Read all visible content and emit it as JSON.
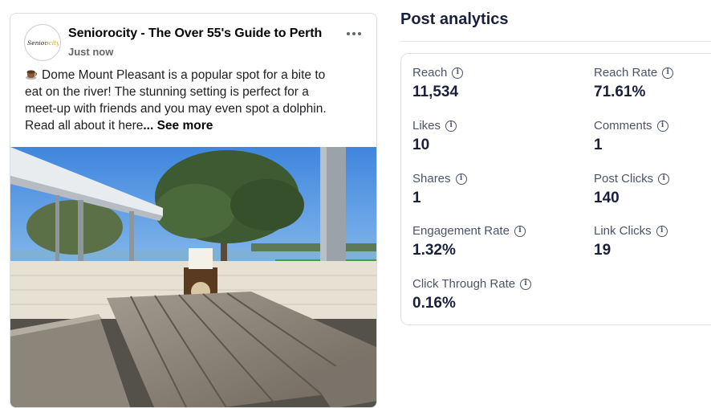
{
  "post": {
    "page_name": "Seniorocity - The Over 55's Guide to Perth",
    "avatar_logo_text": "Seniorocity",
    "time": "Just now",
    "text_lines": [
      "Dome Mount Pleasant is a popular spot for a bite to",
      "eat on the river! The stunning setting is perfect for a",
      "meet-up with friends and you may even spot a dolphin.",
      "Read all about it here... "
    ],
    "see_more": "... See more",
    "text_line4": "Read all about it here",
    "emoji_icon": "coffee-cup-icon",
    "photo_description_icon": "photo"
  },
  "analytics": {
    "title": "Post analytics",
    "metrics": [
      {
        "label": "Reach",
        "value": "11,534"
      },
      {
        "label": "Reach Rate",
        "value": "71.61%"
      },
      {
        "label": "Likes",
        "value": "10"
      },
      {
        "label": "Comments",
        "value": "1"
      },
      {
        "label": "Shares",
        "value": "1"
      },
      {
        "label": "Post Clicks",
        "value": "140"
      },
      {
        "label": "Engagement Rate",
        "value": "1.32%"
      },
      {
        "label": "Link Clicks",
        "value": "19"
      },
      {
        "label": "Click Through Rate",
        "value": "0.16%"
      }
    ],
    "info_icon": "info-icon"
  },
  "colors": {
    "heading": "#1a1f3c",
    "label": "#4b5468",
    "border": "#dfe1e6",
    "sky": "#5a9ee6",
    "grass": "#4e9a3a"
  }
}
